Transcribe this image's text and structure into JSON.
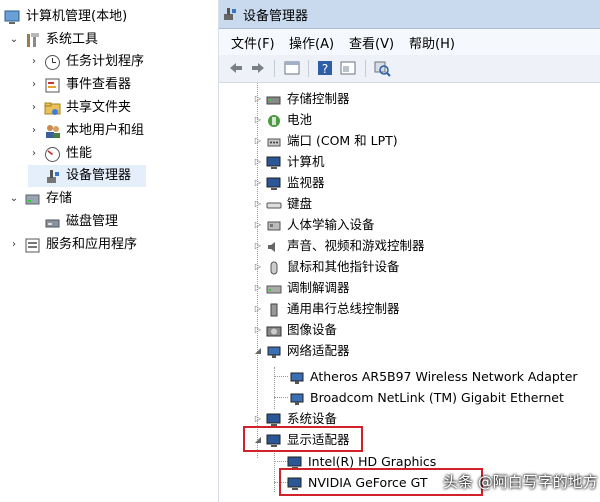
{
  "left_tree": {
    "root": "计算机管理(本地)",
    "system_tools": "系统工具",
    "task_scheduler": "任务计划程序",
    "event_viewer": "事件查看器",
    "shared_folders": "共享文件夹",
    "local_users": "本地用户和组",
    "performance": "性能",
    "device_manager": "设备管理器",
    "storage": "存储",
    "disk_management": "磁盘管理",
    "services": "服务和应用程序"
  },
  "window": {
    "title": "设备管理器",
    "menu": [
      "文件(F)",
      "操作(A)",
      "查看(V)",
      "帮助(H)"
    ]
  },
  "devices": [
    "存储控制器",
    "电池",
    "端口 (COM 和 LPT)",
    "计算机",
    "监视器",
    "键盘",
    "人体学输入设备",
    "声音、视频和游戏控制器",
    "鼠标和其他指针设备",
    "调制解调器",
    "通用串行总线控制器",
    "图像设备",
    "网络适配器",
    "Atheros AR5B97 Wireless Network Adapter",
    "Broadcom NetLink (TM) Gigabit Ethernet",
    "系统设备",
    "显示适配器",
    "Intel(R) HD Graphics",
    "NVIDIA GeForce GT"
  ],
  "watermark": "头条 @阿白写字的地方",
  "colors": {
    "highlight_box": "#d0222a",
    "selection": "#e5eefb"
  }
}
